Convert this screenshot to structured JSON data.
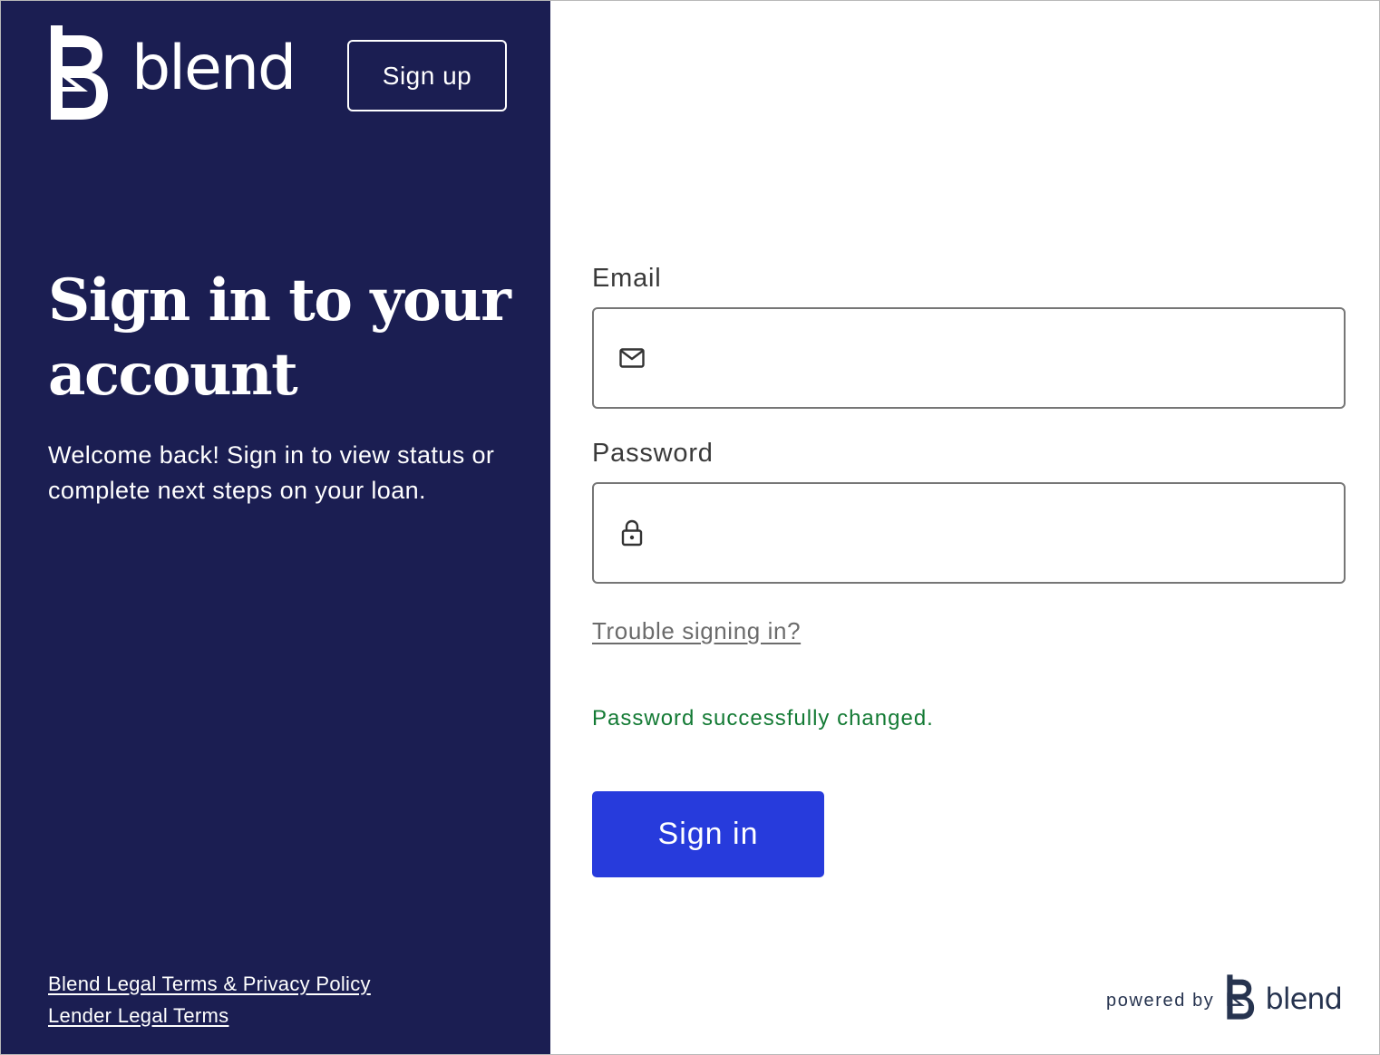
{
  "brand": {
    "name": "blend",
    "color": "#1b1e52",
    "logo_icon": "blend-b-logo-icon"
  },
  "header": {
    "signup_label": "Sign up"
  },
  "hero": {
    "title": "Sign in to your account",
    "subtitle": "Welcome back! Sign in to view status or complete next steps on your loan."
  },
  "footer_links": [
    {
      "label": "Blend Legal Terms & Privacy Policy"
    },
    {
      "label": "Lender Legal Terms"
    }
  ],
  "form": {
    "email": {
      "label": "Email",
      "value": "",
      "placeholder": "",
      "icon": "mail-icon"
    },
    "password": {
      "label": "Password",
      "value": "",
      "placeholder": "",
      "icon": "lock-icon"
    },
    "trouble_link": "Trouble signing in?",
    "success_message": "Password successfully changed.",
    "success_color": "#137a34",
    "submit_label": "Sign in",
    "submit_color": "#273bdc"
  },
  "powered_by": {
    "prefix": "powered by",
    "brand": "blend"
  }
}
